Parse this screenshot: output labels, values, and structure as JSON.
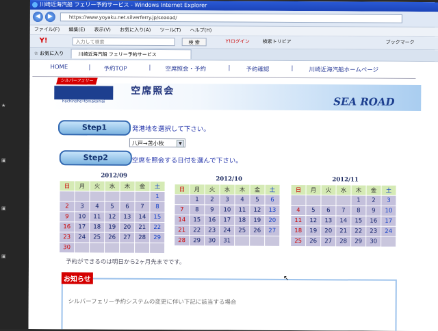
{
  "window_title": "川崎近海汽船 フェリー予約サービス - Windows Internet Explorer",
  "address": "https://www.yoyaku.net.silverferry.jp/seaoad/",
  "menu": [
    "ファイル(F)",
    "編集(E)",
    "表示(V)",
    "お気に入り(A)",
    "ツール(T)",
    "ヘルプ(H)"
  ],
  "toolbar": {
    "search_placeholder": "入力して検索",
    "search_btn": "検 索",
    "login": "Y!ログイン",
    "search_tool": "検索トリビア",
    "bookmark": "ブックマーク"
  },
  "favorites_label": "お気に入り",
  "tab_label": "川崎近海汽船 フェリー予約サービス",
  "site_nav": [
    "HOME",
    "予約TOP",
    "空席照会・予約",
    "予約確認",
    "川崎近海汽船ホームページ"
  ],
  "banner": {
    "ship_ribbon": "シルバーフェリー",
    "ship_caption": "hachinohe•tomakomai",
    "title": "空席照会",
    "logo": "SEA ROAD"
  },
  "step1": {
    "label": "Step1",
    "text": "発港地を選択して下さい。",
    "select_value": "八戸→苫小牧"
  },
  "step2": {
    "label": "Step2",
    "text": "空席を照会する日付を選んで下さい。"
  },
  "weekdays": [
    "日",
    "月",
    "火",
    "水",
    "木",
    "金",
    "土"
  ],
  "calendars": [
    {
      "label": "2012/09",
      "weeks": [
        [
          "",
          "",
          "",
          "",
          "",
          "",
          "1"
        ],
        [
          "2",
          "3",
          "4",
          "5",
          "6",
          "7",
          "8"
        ],
        [
          "9",
          "10",
          "11",
          "12",
          "13",
          "14",
          "15"
        ],
        [
          "16",
          "17",
          "18",
          "19",
          "20",
          "21",
          "22"
        ],
        [
          "23",
          "24",
          "25",
          "26",
          "27",
          "28",
          "29"
        ],
        [
          "30",
          "",
          "",
          "",
          "",
          "",
          ""
        ]
      ]
    },
    {
      "label": "2012/10",
      "weeks": [
        [
          "",
          "1",
          "2",
          "3",
          "4",
          "5",
          "6"
        ],
        [
          "7",
          "8",
          "9",
          "10",
          "11",
          "12",
          "13"
        ],
        [
          "14",
          "15",
          "16",
          "17",
          "18",
          "19",
          "20"
        ],
        [
          "21",
          "22",
          "23",
          "24",
          "25",
          "26",
          "27"
        ],
        [
          "28",
          "29",
          "30",
          "31",
          "",
          "",
          ""
        ]
      ]
    },
    {
      "label": "2012/11",
      "weeks": [
        [
          "",
          "",
          "",
          "",
          "1",
          "2",
          "3"
        ],
        [
          "4",
          "5",
          "6",
          "7",
          "8",
          "9",
          "10"
        ],
        [
          "11",
          "12",
          "13",
          "14",
          "15",
          "16",
          "17"
        ],
        [
          "18",
          "19",
          "20",
          "21",
          "22",
          "23",
          "24"
        ],
        [
          "25",
          "26",
          "27",
          "28",
          "29",
          "30",
          ""
        ]
      ]
    }
  ],
  "note": "予約ができるのは明日から2ヶ月先までです。",
  "notice": {
    "title": "お知らせ",
    "text": "シルバーフェリー予約システムの変更に伴い下記に該当する場合"
  }
}
